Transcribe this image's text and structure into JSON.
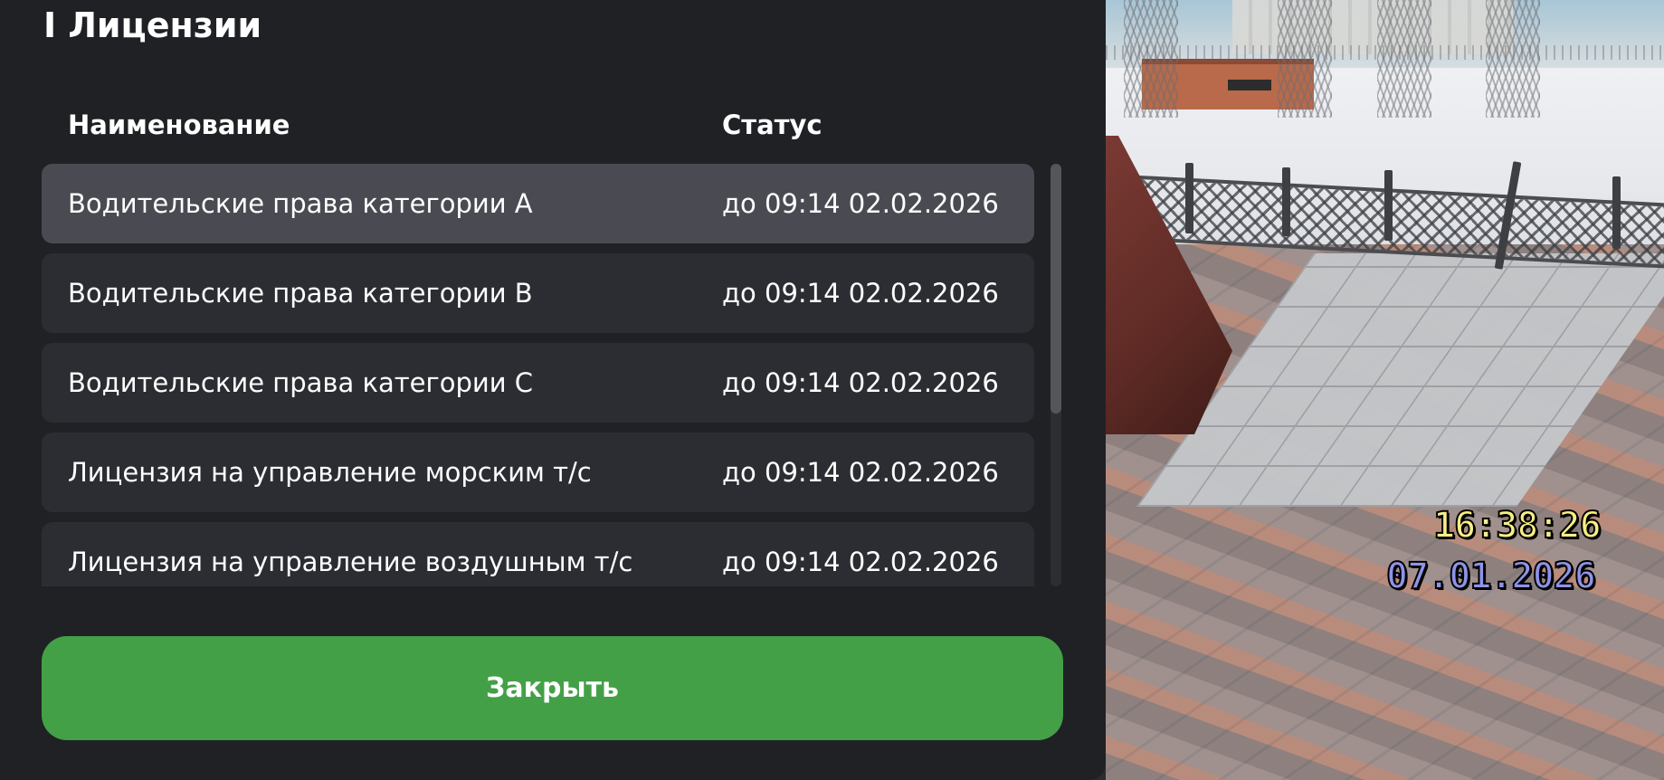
{
  "panel": {
    "title": "I Лицензии",
    "columns": {
      "name": "Наименование",
      "status": "Статус"
    },
    "rows": [
      {
        "name": "Водительские права категории A",
        "status": "до 09:14 02.02.2026"
      },
      {
        "name": "Водительские права категории B",
        "status": "до 09:14 02.02.2026"
      },
      {
        "name": "Водительские права категории C",
        "status": "до 09:14 02.02.2026"
      },
      {
        "name": "Лицензия на управление морским т/с",
        "status": "до 09:14 02.02.2026"
      },
      {
        "name": "Лицензия на управление воздушным т/с",
        "status": "до 09:14 02.02.2026"
      }
    ],
    "selected_row": 0,
    "close_label": "Закрыть"
  },
  "hud": {
    "time": "16:38:26",
    "date": "07.01.2026"
  },
  "colors": {
    "panel_bg": "#202125",
    "row_bg": "#2c2d32",
    "row_active_bg": "#4a4b52",
    "accent_green": "#43a047",
    "hud_time": "#f7ee86",
    "hud_date": "#8e93e8"
  }
}
